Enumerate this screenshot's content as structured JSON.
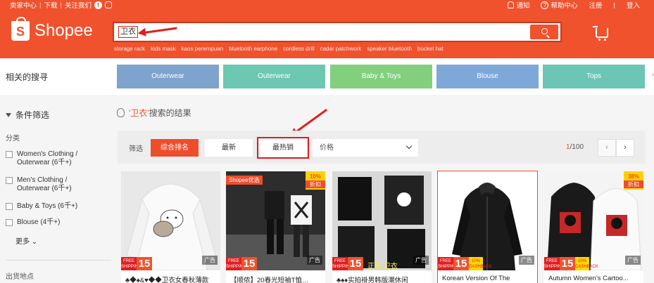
{
  "topbar": {
    "seller_center": "卖家中心",
    "download": "下载",
    "follow_us": "关注我们",
    "facebook_glyph": "f",
    "notifications": "通知",
    "help_center": "帮助中心",
    "register": "注册",
    "login": "登入"
  },
  "brand": {
    "logo_glyph": "S",
    "name": "Shopee"
  },
  "search": {
    "query": "卫衣",
    "keywords": [
      "storage rack",
      "kids mask",
      "kaos perempuan",
      "bluetooth earphone",
      "cordless drill",
      "cadar patchwork",
      "speaker bluetooth",
      "bucket hat"
    ]
  },
  "related": {
    "label": "相关的搜寻",
    "chips": [
      {
        "label": "Outerwear",
        "color": "#7ea3cc"
      },
      {
        "label": "Outerwear",
        "color": "#6cc8b0"
      },
      {
        "label": "Baby & Toys",
        "color": "#82cf7e"
      },
      {
        "label": "Blouse",
        "color": "#7ea8d8"
      },
      {
        "label": "Tops",
        "color": "#6bc6b6"
      }
    ],
    "more": "›"
  },
  "sidebar": {
    "title": "条件筛选",
    "category_label": "分类",
    "items": [
      {
        "label": "Women's Clothing / Outerwear (6千+)"
      },
      {
        "label": "Men's Clothing / Outerwear (6千+)"
      },
      {
        "label": "Baby & Toys (6千+)"
      },
      {
        "label": "Blouse (4千+)"
      }
    ],
    "more": "更多",
    "origin_label": "出货地点"
  },
  "results": {
    "keyword": "'卫衣'",
    "suffix": "搜索的结果"
  },
  "filters": {
    "label": "筛选",
    "relevance": "综合排名",
    "latest": "最新",
    "top_sales": "最热销",
    "price": "价格",
    "page_current": "1",
    "page_total": "/100",
    "prev": "‹",
    "next": "›"
  },
  "products": [
    {
      "title": "♣◆♠&♥◆◆卫衣女春秋薄款",
      "ad": "广告",
      "ship_num": "15",
      "ship_text": "FREE SHIPPING",
      "palette": "white"
    },
    {
      "title": "【顺侬】20春光短袖T恤…",
      "ad": "广告",
      "ship_num": "15",
      "ship_text": "FREE SHIPPING",
      "pref": "Shopee优选",
      "discount": "10%",
      "discount_word": "折扣",
      "palette": "street"
    },
    {
      "title": "♣♠♦实拍褂男韩版潮休闲",
      "ad": "广告",
      "ship_num": "15",
      "ship_text": "FREE SHIPPING",
      "overlay": "正品 卫衣",
      "palette": "black"
    },
    {
      "title": "Korean Version Of The",
      "ad": "广告",
      "ship_num": "15",
      "ship_text": "FREE SHIPPING",
      "cashback": "10% CASHBACK",
      "palette": "hoodie"
    },
    {
      "title": "Autumn Women's Cartoo...",
      "ad": "广告",
      "ship_num": "15",
      "ship_text": "FREE SHIPPING",
      "cashback": "10% CASHBACK",
      "discount": "38%",
      "discount_word": "折扣",
      "palette": "mickey"
    }
  ],
  "colors": {
    "brand": "#f0522d",
    "annotation": "#e31d1d"
  }
}
